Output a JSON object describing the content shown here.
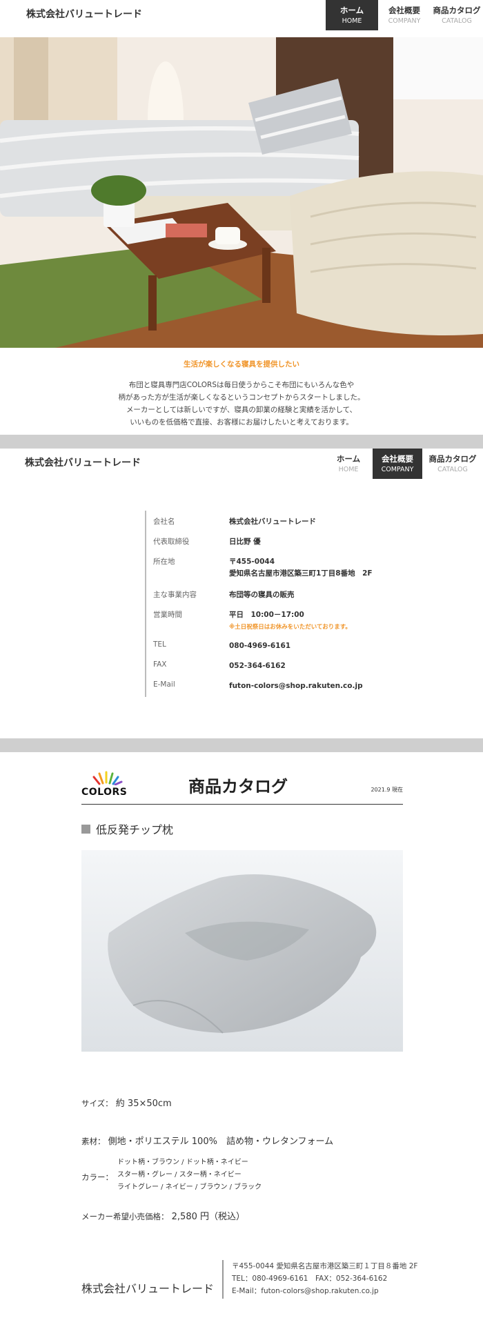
{
  "brand": "株式会社バリュートレード",
  "nav": [
    {
      "jp": "ホーム",
      "en": "HOME"
    },
    {
      "jp": "会社概要",
      "en": "COMPANY"
    },
    {
      "jp": "商品カタログ",
      "en": "CATALOG"
    }
  ],
  "intro": {
    "title": "生活が楽しくなる寝具を提供したい",
    "lines": [
      "布団と寝具専門店COLORSは毎日使うからこそ布団にもいろんな色や",
      "柄があった方が生活が楽しくなるというコンセプトからスタートしました。",
      "メーカーとしては新しいですが、寝具の卸業の経験と実績を活かして、",
      "いいものを低価格で直接、お客様にお届けしたいと考えております。"
    ]
  },
  "company": {
    "rows": [
      {
        "key": "会社名",
        "value": "株式会社バリュートレード"
      },
      {
        "key": "代表取締役",
        "value": "日比野 優"
      },
      {
        "key": "所在地",
        "value": "〒455-0044",
        "value2": "愛知県名古屋市港区築三町1丁目8番地　2F"
      },
      {
        "key": "主な事業内容",
        "value": "布団等の寝具の販売"
      },
      {
        "key": "営業時間",
        "value": "平日　10:00－17:00",
        "note": "※土日祝祭日はお休みをいただいております。"
      },
      {
        "key": "TEL",
        "value": "080-4969-6161"
      },
      {
        "key": "FAX",
        "value": "052-364-6162"
      },
      {
        "key": "E-Mail",
        "value": "futon-colors@shop.rakuten.co.jp"
      }
    ]
  },
  "catalog": {
    "logo_text": "COLORS",
    "title": "商品カタログ",
    "date": "2021.9 現在",
    "product_name": "低反発チップ枕",
    "size_label": "サイズ：",
    "size_value": "約 35×50cm",
    "material_label": "素材：",
    "material_value": "側地・ポリエステル 100%　詰め物・ウレタンフォーム",
    "color_label": "カラー：",
    "colors": [
      "ドット柄・ブラウン / ドット柄・ネイビー",
      "スター柄・グレー / スター柄・ネイビー",
      "ライトグレー / ネイビー / ブラウン / ブラック"
    ],
    "price_label": "メーカー希望小売価格：",
    "price_value": "2,580 円（税込）"
  },
  "footer": {
    "name": "株式会社バリュートレード",
    "lines": [
      "〒455-0044 愛知県名古屋市港区築三町１丁目８番地 2F",
      "TEL：080-4969-6161　FAX：052-364-6162",
      "E-Mail：futon-colors@shop.rakuten.co.jp"
    ]
  },
  "colors": {
    "accent": "#f0952a",
    "nav_active": "#333333",
    "band": "#cfcfcf"
  }
}
